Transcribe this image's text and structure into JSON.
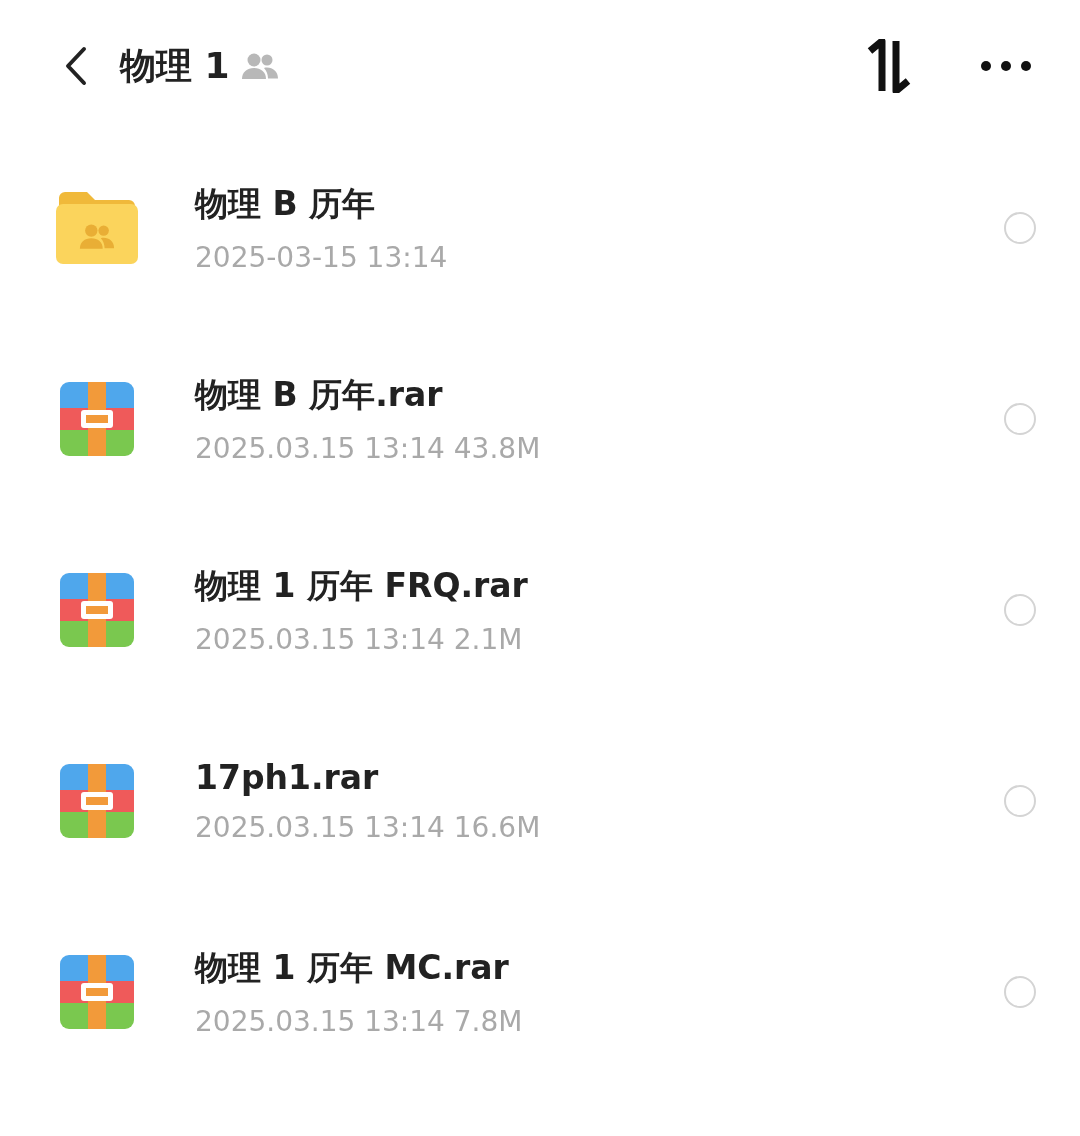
{
  "header": {
    "title": "物理 1",
    "shared": true
  },
  "files": [
    {
      "kind": "folder",
      "name": "物理 B 历年",
      "meta": "2025-03-15 13:14",
      "selected": false
    },
    {
      "kind": "archive",
      "name": "物理 B 历年.rar",
      "meta": "2025.03.15 13:14 43.8M",
      "selected": false
    },
    {
      "kind": "archive",
      "name": "物理 1 历年 FRQ.rar",
      "meta": "2025.03.15 13:14 2.1M",
      "selected": false
    },
    {
      "kind": "archive",
      "name": "17ph1.rar",
      "meta": "2025.03.15 13:14 16.6M",
      "selected": false
    },
    {
      "kind": "archive",
      "name": "物理 1 历年 MC.rar",
      "meta": "2025.03.15 13:14 7.8M",
      "selected": false
    }
  ]
}
